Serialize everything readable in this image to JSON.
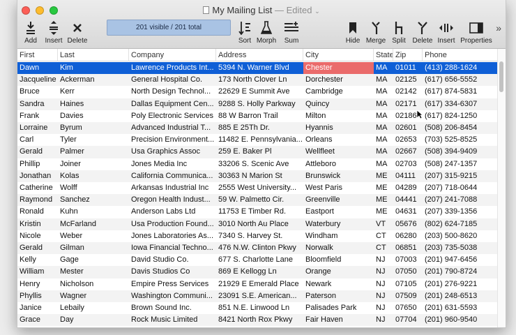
{
  "window": {
    "title": "My Mailing List",
    "edited": "— Edited"
  },
  "toolbar": {
    "add": "Add",
    "insert": "Insert",
    "delete": "Delete",
    "status": "201 visible / 201 total",
    "sort": "Sort",
    "morph": "Morph",
    "sum": "Sum",
    "hide": "Hide",
    "merge": "Merge",
    "split": "Split",
    "delete_col": "Delete",
    "insert_col": "Insert",
    "properties": "Properties",
    "more": "»"
  },
  "columns": [
    "First",
    "Last",
    "Company",
    "Address",
    "City",
    "State",
    "Zip",
    "Phone"
  ],
  "rows": [
    [
      "Dawn",
      "Kim",
      "Lawrence Products Int...",
      "5394 N. Warner Blvd",
      "Chester",
      "MA",
      "01011",
      "(413) 288-1624"
    ],
    [
      "Jacqueline",
      "Ackerman",
      "General Hospital Co.",
      "173 North Clover Ln",
      "Dorchester",
      "MA",
      "02125",
      "(617) 656-5552"
    ],
    [
      "Bruce",
      "Kerr",
      "North Design Technol...",
      "22629 E Summit Ave",
      "Cambridge",
      "MA",
      "02142",
      "(617) 874-5831"
    ],
    [
      "Sandra",
      "Haines",
      "Dallas Equipment Cen...",
      "9288 S. Holly Parkway",
      "Quincy",
      "MA",
      "02171",
      "(617) 334-6307"
    ],
    [
      "Frank",
      "Davies",
      "Poly Electronic Services",
      "88 W Barron Trail",
      "Milton",
      "MA",
      "02186",
      "(617) 824-1250"
    ],
    [
      "Lorraine",
      "Byrum",
      "Advanced Industrial T...",
      "885 E 25Th Dr.",
      "Hyannis",
      "MA",
      "02601",
      "(508) 206-8454"
    ],
    [
      "Carl",
      "Tyler",
      "Precision Environment...",
      "11482 E. Pennsylvania...",
      "Orleans",
      "MA",
      "02653",
      "(703) 525-8525"
    ],
    [
      "Gerald",
      "Palmer",
      "Usa Graphics Assoc",
      "259 E. Baker Pl",
      "Wellfleet",
      "MA",
      "02667",
      "(508) 394-9409"
    ],
    [
      "Phillip",
      "Joiner",
      "Jones Media Inc",
      "33206 S. Scenic Ave",
      "Attleboro",
      "MA",
      "02703",
      "(508) 247-1357"
    ],
    [
      "Jonathan",
      "Kolas",
      "California Communica...",
      "30363 N Marion St",
      "Brunswick",
      "ME",
      "04111",
      "(207) 315-9215"
    ],
    [
      "Catherine",
      "Wolff",
      "Arkansas Industrial Inc",
      "2555 West University...",
      "West Paris",
      "ME",
      "04289",
      "(207) 718-0644"
    ],
    [
      "Raymond",
      "Sanchez",
      "Oregon Health Indust...",
      "59 W. Palmetto Cir.",
      "Greenville",
      "ME",
      "04441",
      "(207) 241-7088"
    ],
    [
      "Ronald",
      "Kuhn",
      "Anderson Labs Ltd",
      "11753 E Timber Rd.",
      "Eastport",
      "ME",
      "04631",
      "(207) 339-1356"
    ],
    [
      "Kristin",
      "McFarland",
      "Usa Production Found...",
      "3010 North Au Place",
      "Waterbury",
      "VT",
      "05676",
      "(802) 624-7185"
    ],
    [
      "Nicole",
      "Weber",
      "Jones Laboratories As...",
      "7340 S. Harvey St.",
      "Windham",
      "CT",
      "06280",
      "(203) 500-8620"
    ],
    [
      "Gerald",
      "Gilman",
      "Iowa Financial Techno...",
      "476 N.W. Clinton Pkwy",
      "Norwalk",
      "CT",
      "06851",
      "(203) 735-5038"
    ],
    [
      "Kelly",
      "Gage",
      "David Studio Co.",
      "677 S. Charlotte Lane",
      "Bloomfield",
      "NJ",
      "07003",
      "(201) 947-6456"
    ],
    [
      "William",
      "Mester",
      "Davis Studios Co",
      "869 E Kellogg Ln",
      "Orange",
      "NJ",
      "07050",
      "(201) 790-8724"
    ],
    [
      "Henry",
      "Nicholson",
      "Empire Press Services",
      "21929 E Emerald Place",
      "Newark",
      "NJ",
      "07105",
      "(201) 276-9221"
    ],
    [
      "Phyllis",
      "Wagner",
      "Washington Communi...",
      "23091 S.E. American...",
      "Paterson",
      "NJ",
      "07509",
      "(201) 248-6513"
    ],
    [
      "Janice",
      "Lebaily",
      "Brown Sound Inc.",
      "851 N.E. Linwood Ln",
      "Palisades Park",
      "NJ",
      "07650",
      "(201) 631-5593"
    ],
    [
      "Grace",
      "Day",
      "Rock Music Limited",
      "8421 North Rox Pkwy",
      "Fair Haven",
      "NJ",
      "07704",
      "(201) 960-9540"
    ]
  ],
  "colors": {
    "selection": "#0f5fd6",
    "highlight_cell": "#ea6b6b",
    "status_box": "#a9c3e4"
  }
}
